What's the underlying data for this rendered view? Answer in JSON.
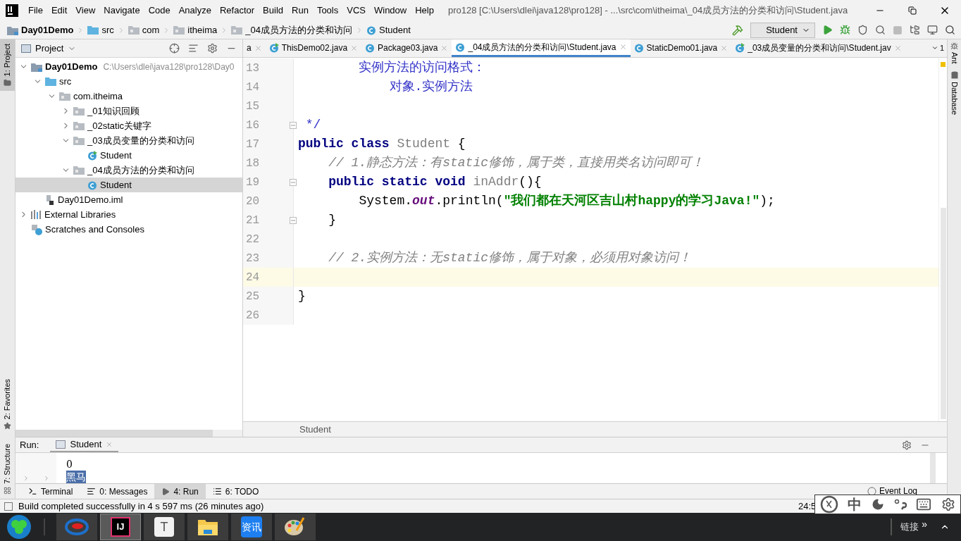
{
  "menu": [
    "File",
    "Edit",
    "View",
    "Navigate",
    "Code",
    "Analyze",
    "Refactor",
    "Build",
    "Run",
    "Tools",
    "VCS",
    "Window",
    "Help"
  ],
  "window": {
    "title": "pro128 [C:\\Users\\dlei\\java128\\pro128] - ...\\src\\com\\itheima\\_04成员方法的分类和访问\\Student.java"
  },
  "breadcrumb": [
    {
      "label": "Day01Demo",
      "kind": "module"
    },
    {
      "label": "src",
      "kind": "folder"
    },
    {
      "label": "com",
      "kind": "folder"
    },
    {
      "label": "itheima",
      "kind": "folder"
    },
    {
      "label": "_04成员方法的分类和访问",
      "kind": "folder"
    },
    {
      "label": "Student",
      "kind": "class"
    }
  ],
  "run_config": "Student",
  "left_stripe": [
    "1: Project",
    "2: Favorites",
    "7: Structure"
  ],
  "right_stripe": [
    "Ant",
    "Database"
  ],
  "project_panel": {
    "title": "Project"
  },
  "tree": [
    {
      "label": "Day01Demo",
      "kind": "module",
      "hint": "C:\\Users\\dlei\\java128\\pro128\\Day0",
      "expanded": true,
      "selected": false,
      "children": [
        {
          "label": "src",
          "kind": "source",
          "expanded": true,
          "selected": false,
          "children": [
            {
              "label": "com.itheima",
              "kind": "package",
              "expanded": true,
              "selected": false,
              "children": [
                {
                  "label": "_01知识回顾",
                  "kind": "package",
                  "expanded": false,
                  "selected": false
                },
                {
                  "label": "_02static关键字",
                  "kind": "package",
                  "expanded": false,
                  "selected": false
                },
                {
                  "label": "_03成员变量的分类和访问",
                  "kind": "package",
                  "expanded": true,
                  "selected": false,
                  "children": [
                    {
                      "label": "Student",
                      "kind": "runnable",
                      "selected": false
                    }
                  ]
                },
                {
                  "label": "_04成员方法的分类和访问",
                  "kind": "package",
                  "expanded": true,
                  "selected": false,
                  "children": [
                    {
                      "label": "Student",
                      "kind": "class",
                      "selected": true
                    }
                  ]
                }
              ]
            }
          ]
        },
        {
          "label": "Day01Demo.iml",
          "kind": "file",
          "selected": false
        }
      ]
    },
    {
      "label": "External Libraries",
      "kind": "libraries",
      "expanded": false,
      "selected": false
    },
    {
      "label": "Scratches and Consoles",
      "kind": "scratches",
      "selected": false
    }
  ],
  "tabs": [
    {
      "label": "a",
      "kind": "cut",
      "selected": false
    },
    {
      "label": "ThisDemo02.java",
      "kind": "runnable",
      "selected": false
    },
    {
      "label": "Package03.java",
      "kind": "class",
      "selected": false
    },
    {
      "label": "_04成员方法的分类和访问\\Student.java",
      "kind": "class",
      "selected": true
    },
    {
      "label": "StaticDemo01.java",
      "kind": "class",
      "selected": false
    },
    {
      "label": "_03成员变量的分类和访问\\Student.jav",
      "kind": "runnable",
      "selected": false
    }
  ],
  "tab_overflow": "1",
  "code": [
    {
      "number": "13",
      "fold": false,
      "current": false,
      "tokens": [
        {
          "kind": "doc",
          "text": "        实例方法的访问格式："
        }
      ]
    },
    {
      "number": "14",
      "fold": false,
      "current": false,
      "tokens": [
        {
          "kind": "doc",
          "text": "            对象.实例方法"
        }
      ]
    },
    {
      "number": "15",
      "fold": false,
      "current": false
    },
    {
      "number": "16",
      "fold": true,
      "current": false,
      "tokens": [
        {
          "kind": "doc",
          "text": " */"
        }
      ]
    },
    {
      "number": "17",
      "fold": false,
      "current": false,
      "tokens": [
        {
          "kind": "keyword",
          "text": "public class "
        },
        {
          "kind": "unused",
          "text": "Student"
        },
        {
          "kind": "plain",
          "text": " {"
        }
      ]
    },
    {
      "number": "18",
      "fold": false,
      "current": false,
      "tokens": [
        {
          "kind": "comment",
          "text": "    // 1.静态方法：有static修饰，属于类，直接用类名访问即可！"
        }
      ]
    },
    {
      "number": "19",
      "fold": true,
      "current": false,
      "tokens": [
        {
          "kind": "keyword",
          "text": "    public static void "
        },
        {
          "kind": "unused",
          "text": "inAddr"
        },
        {
          "kind": "plain",
          "text": "(){"
        }
      ]
    },
    {
      "number": "20",
      "fold": false,
      "current": false,
      "tokens": [
        {
          "kind": "plain",
          "text": "        System."
        },
        {
          "kind": "field",
          "text": "out"
        },
        {
          "kind": "plain",
          "text": ".println("
        },
        {
          "kind": "string",
          "text": "\"我们都在天河区吉山村happy的学习Java!\""
        },
        {
          "kind": "plain",
          "text": ");"
        }
      ]
    },
    {
      "number": "21",
      "fold": true,
      "current": false,
      "tokens": [
        {
          "kind": "plain",
          "text": "    }"
        }
      ]
    },
    {
      "number": "22",
      "fold": false,
      "current": false
    },
    {
      "number": "23",
      "fold": false,
      "current": false,
      "tokens": [
        {
          "kind": "comment",
          "text": "    // 2.实例方法：无static修饰，属于对象，必须用对象访问！"
        }
      ]
    },
    {
      "number": "24",
      "fold": false,
      "current": true
    },
    {
      "number": "25",
      "fold": false,
      "current": false,
      "tokens": [
        {
          "kind": "plain",
          "text": "}"
        }
      ]
    },
    {
      "number": "26",
      "fold": false,
      "current": false
    }
  ],
  "editor_breadcrumb": "Student",
  "run_panel": {
    "label": "Run:",
    "tab": "Student",
    "output": [
      {
        "text": "0",
        "selected": false
      },
      {
        "text": "黑马",
        "selected": true
      }
    ]
  },
  "tool_tabs": [
    {
      "label": "Terminal",
      "kind": "terminal",
      "selected": false
    },
    {
      "label": "0: Messages",
      "kind": "messages",
      "selected": false
    },
    {
      "label": "4: Run",
      "kind": "run",
      "selected": true
    },
    {
      "label": "6: TODO",
      "kind": "todo",
      "selected": false
    }
  ],
  "event_log": "Event Log",
  "status": {
    "message": "Build completed successfully in 4 s 597 ms (26 minutes ago)",
    "position": "24:5"
  },
  "ime": {
    "mode": "中"
  },
  "taskbar": {
    "apps": [
      {
        "kind": "swirl",
        "selected": false
      },
      {
        "kind": "intellij",
        "text": "IJ",
        "selected": true
      },
      {
        "kind": "typora",
        "text": "T",
        "selected": false
      },
      {
        "kind": "explorer",
        "selected": false
      },
      {
        "kind": "news",
        "text": "资讯",
        "selected": false
      },
      {
        "kind": "paint",
        "selected": false
      }
    ],
    "links": "链接",
    "more": "»"
  }
}
